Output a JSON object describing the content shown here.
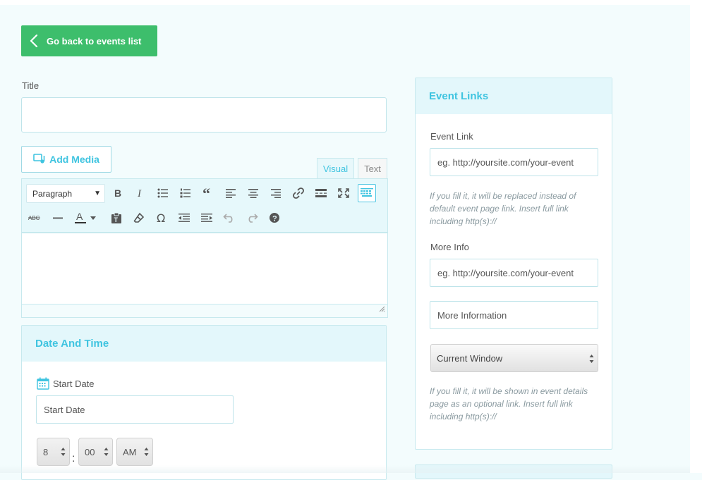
{
  "back_button": {
    "label": "Go back to events list",
    "icon": "chevron-left-icon"
  },
  "title_field": {
    "label": "Title",
    "value": ""
  },
  "editor": {
    "add_media_label": "Add Media",
    "tabs": {
      "visual": "Visual",
      "text": "Text",
      "active": "Visual"
    },
    "format_select": "Paragraph",
    "toolbar_row1": [
      "bold-icon",
      "italic-icon",
      "bullet-list-icon",
      "numbered-list-icon",
      "blockquote-icon",
      "align-left-icon",
      "align-center-icon",
      "align-right-icon",
      "link-icon",
      "read-more-icon",
      "fullscreen-icon",
      "toolbar-toggle-icon"
    ],
    "toolbar_row2": [
      "strikethrough-icon",
      "horizontal-line-icon",
      "text-color-icon",
      "paste-text-icon",
      "clear-formatting-icon",
      "special-character-icon",
      "outdent-icon",
      "indent-icon",
      "undo-icon",
      "redo-icon",
      "help-icon"
    ],
    "content": ""
  },
  "date_time": {
    "heading": "Date And Time",
    "start_date_label": "Start Date",
    "start_date_placeholder": "Start Date",
    "hour": "8",
    "minute": "00",
    "ampm": "AM",
    "separator": ":"
  },
  "event_links": {
    "heading": "Event Links",
    "event_link_label": "Event Link",
    "event_link_placeholder": "eg. http://yoursite.com/your-event",
    "event_link_help": "If you fill it, it will be replaced instead of default event page link. Insert full link including http(s)://",
    "more_info_label": "More Info",
    "more_info_placeholder": "eg. http://yoursite.com/your-event",
    "more_info_title_placeholder": "More Information",
    "target_select": "Current Window",
    "more_info_help": "If you fill it, it will be shown in event details page as an optional link. Insert full link including http(s)://"
  },
  "colors": {
    "accent": "#3fc4e0",
    "button_green": "#3dbe6c",
    "panel_head_bg": "#e3f7fb",
    "page_bg": "#f3fcfd"
  }
}
